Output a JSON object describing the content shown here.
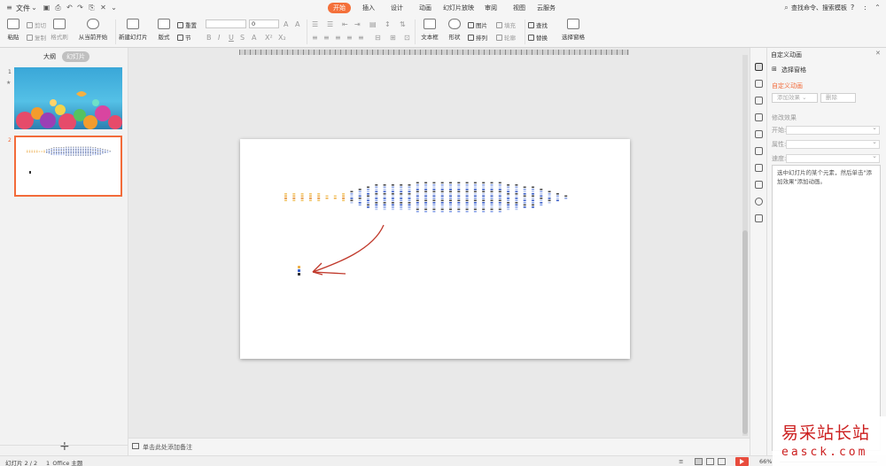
{
  "menubar": {
    "file_label": "文件",
    "tabs": [
      "开始",
      "插入",
      "设计",
      "动画",
      "幻灯片放映",
      "审阅",
      "视图",
      "云服务"
    ],
    "active_tab": "开始",
    "search_placeholder": "查找命令、搜索模板",
    "help": "?",
    "sep": ":"
  },
  "ribbon": {
    "paste": "粘贴",
    "cut": "剪切",
    "copy": "复制",
    "format_painter": "格式刷",
    "from_current": "从当前开始",
    "new_slide": "新建幻灯片",
    "layout": "版式",
    "reset": "重置",
    "section": "节",
    "font_value": "",
    "font_size_value": "0",
    "textbox": "文本框",
    "shapes": "形状",
    "picture": "图片",
    "fill": "填充",
    "find": "查找",
    "arrange": "排列",
    "outline": "轮廓",
    "replace": "替换",
    "select_pane": "选择窗格"
  },
  "leftpanel": {
    "tab_outline": "大纲",
    "tab_slides": "幻灯片",
    "slide1_num": "1",
    "slide2_num": "2",
    "add": "+"
  },
  "notes": {
    "placeholder": "单击此处添加备注"
  },
  "pane": {
    "title": "自定义动画",
    "select_pane": "选择窗格",
    "section_title": "自定义动画",
    "add_effect": "添加效果",
    "delete": "删除",
    "modify_effect": "修改效果",
    "start_label": "开始:",
    "property_label": "属性:",
    "speed_label": "速度:",
    "hint": "选中幻灯片的某个元素，然后单击\"添加效果\"添加动画。"
  },
  "status": {
    "slide_info": "幻灯片 2 / 2",
    "theme": "1_Office 主题",
    "zoom": "66%"
  },
  "watermark": {
    "line1": "易采站长站",
    "line2": "easck.com"
  },
  "chart_data": {
    "type": "bar",
    "title": "",
    "xlabel": "",
    "ylabel": "",
    "categories": [],
    "values": [
      2,
      2,
      2,
      2,
      2,
      1,
      1,
      2,
      3,
      4,
      5,
      6,
      6,
      6,
      6,
      6,
      7,
      7,
      7,
      7,
      7,
      7,
      7,
      7,
      7,
      7,
      7,
      6,
      6,
      5,
      5,
      4,
      3,
      2,
      1
    ],
    "colors": [
      "#f2c76e",
      "#f0b24c",
      "#e58f3a",
      "#4a4a4a",
      "#3b5fc8",
      "#8aa4e8",
      "#b8c8f0"
    ]
  }
}
